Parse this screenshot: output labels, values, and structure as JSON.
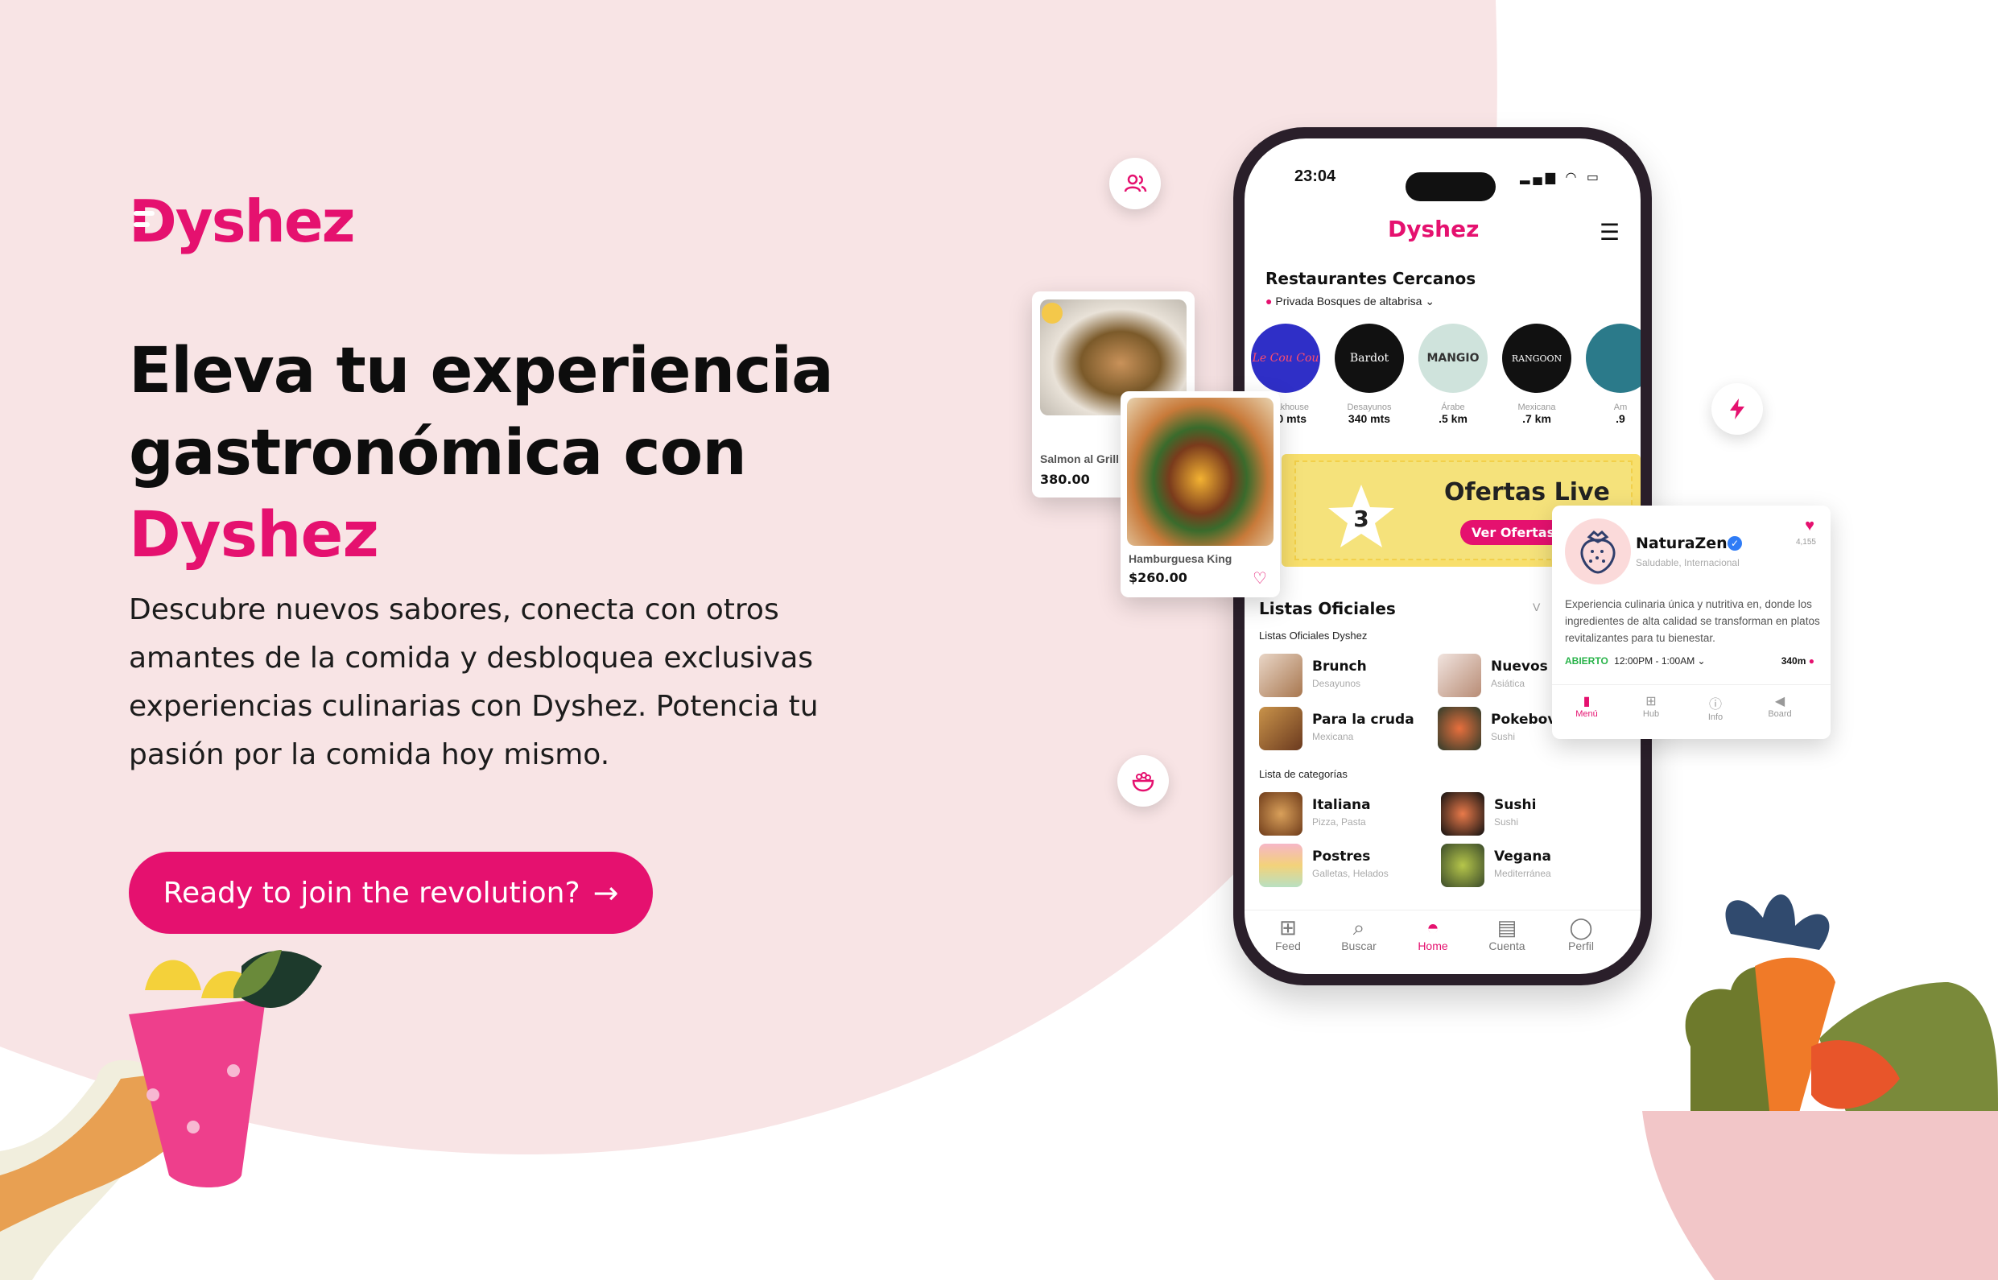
{
  "brand": {
    "logo_text": "Dyshez",
    "accent_color": "#e5116f",
    "background_blob_color": "#f8e4e5"
  },
  "hero": {
    "headline_line1": "Eleva tu experiencia",
    "headline_line2": "gastronómica con",
    "headline_brand": "Dyshez",
    "description": "Descubre nuevos sabores, conecta con otros amantes de la comida y desbloquea exclusivas experiencias culinarias con Dyshez. Potencia tu pasión por la comida hoy mismo.",
    "cta_label": "Ready to join the revolution?",
    "cta_icon": "arrow-right-icon"
  },
  "phone": {
    "status": {
      "time": "23:04"
    },
    "app_logo": "Dyshez",
    "nearby": {
      "title": "Restaurantes Cercanos",
      "location": "Privada Bosques de altabrisa",
      "restaurants": [
        {
          "name": "Le Cou Cou",
          "category": "Steakhouse",
          "distance": "100 mts",
          "color": "#2f2fc7"
        },
        {
          "name": "Bardot",
          "category": "Desayunos",
          "distance": "340 mts",
          "color": "#111111"
        },
        {
          "name": "MANGIO",
          "category": "Árabe",
          "distance": ".5 km",
          "color": "#cfe3dc"
        },
        {
          "name": "RANGOON",
          "category": "Mexicana",
          "distance": ".7 km",
          "color": "#111111"
        },
        {
          "name": "",
          "category": "Am",
          "distance": ".9",
          "color": "#2b7a8a"
        }
      ]
    },
    "offers": {
      "count": "3",
      "title": "Ofertas Live",
      "button": "Ver Ofertas"
    },
    "official_lists": {
      "title": "Listas Oficiales",
      "see_all": "V",
      "subtitle": "Listas Oficiales Dyshez",
      "items": [
        {
          "name": "Brunch",
          "sub": "Desayunos"
        },
        {
          "name": "Nuevos i",
          "sub": "Asiática"
        },
        {
          "name": "Para la cruda",
          "sub": "Mexicana"
        },
        {
          "name": "Pokebov",
          "sub": "Sushi"
        }
      ]
    },
    "categories": {
      "title": "Lista de categorías",
      "items": [
        {
          "name": "Italiana",
          "sub": "Pizza, Pasta"
        },
        {
          "name": "Sushi",
          "sub": "Sushi"
        },
        {
          "name": "Postres",
          "sub": "Galletas, Helados"
        },
        {
          "name": "Vegana",
          "sub": "Mediterránea"
        }
      ]
    },
    "tabs": [
      {
        "label": "Feed",
        "icon": "feed-icon"
      },
      {
        "label": "Buscar",
        "icon": "search-icon"
      },
      {
        "label": "Home",
        "icon": "home-icon"
      },
      {
        "label": "Cuenta",
        "icon": "receipt-icon"
      },
      {
        "label": "Perfil",
        "icon": "profile-icon"
      }
    ],
    "active_tab": "Home"
  },
  "dish_cards": [
    {
      "name": "Salmon al Grill",
      "price": "380.00",
      "liked": true
    },
    {
      "name": "Hamburguesa King",
      "price": "$260.00",
      "liked": false
    }
  ],
  "profile_card": {
    "name": "NaturaZen",
    "tags": "Saludable, Internacional",
    "likes": "4,155",
    "description": "Experiencia culinaria única y nutritiva en, donde los ingredientes de alta calidad se transforman en platos revitalizantes para tu bienestar.",
    "status": "ABIERTO",
    "hours": "12:00PM - 1:00AM",
    "distance": "340m",
    "tabs": [
      "Menú",
      "Hub",
      "Info",
      "Board"
    ],
    "active_tab": "Menú"
  },
  "floating_icons": [
    "users-icon",
    "lightning-icon",
    "bowl-icon"
  ]
}
